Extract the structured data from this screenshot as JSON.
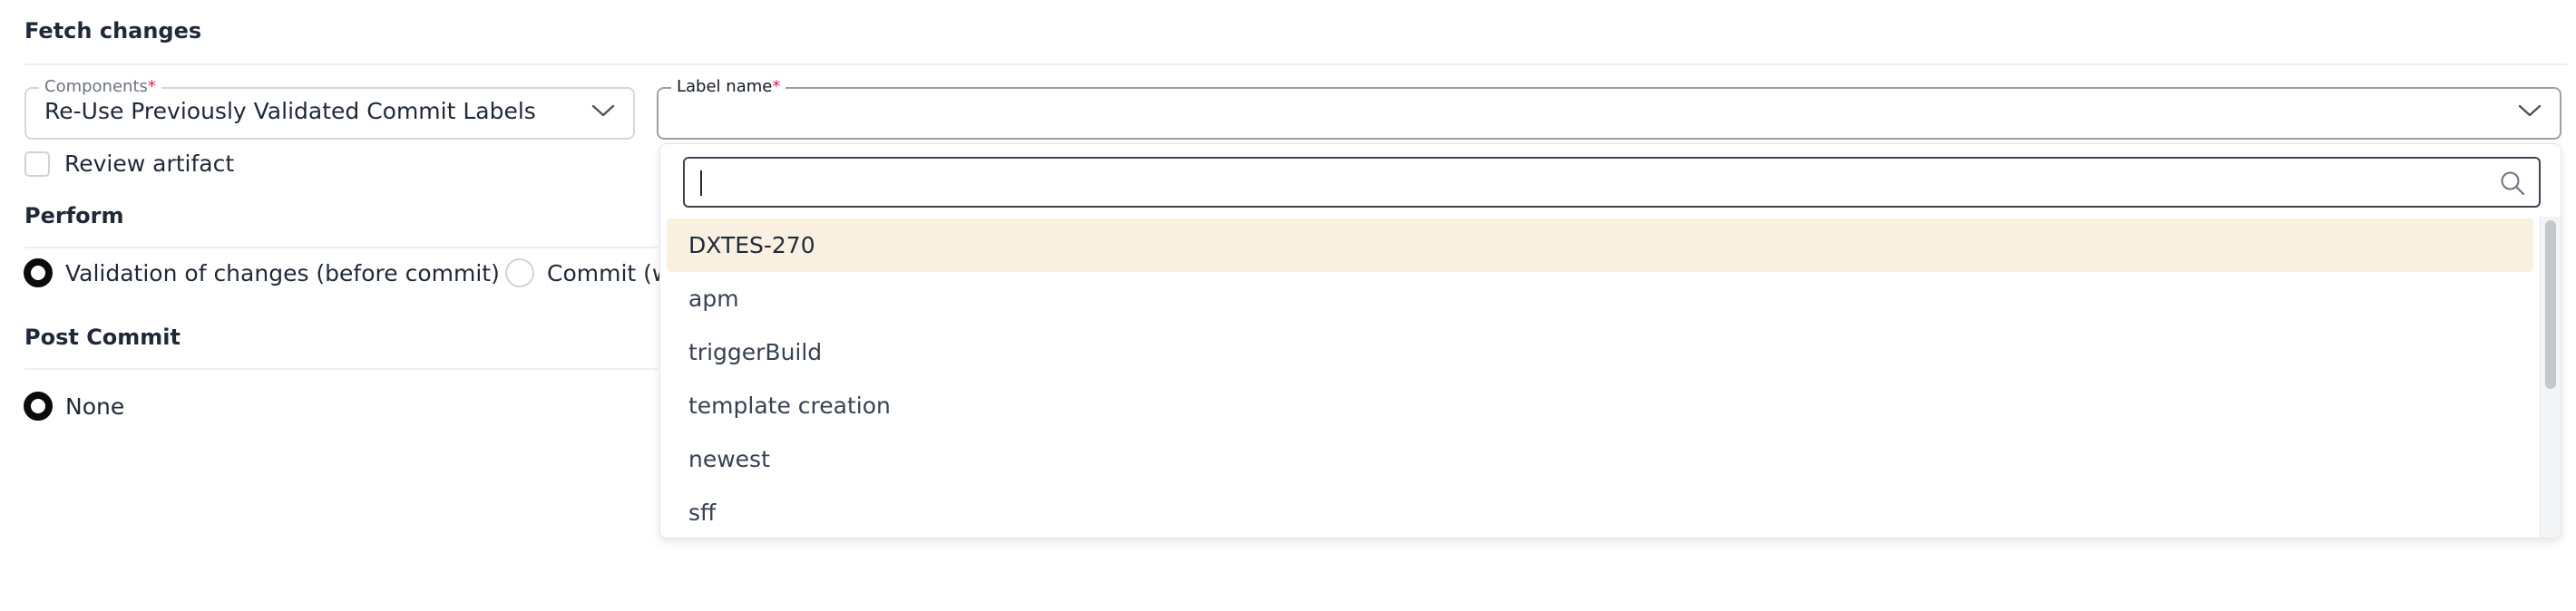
{
  "fetch_changes": {
    "title": "Fetch changes",
    "components": {
      "legend": "Components",
      "required_mark": "*",
      "value": "Re-Use Previously Validated Commit Labels"
    },
    "label_name": {
      "legend": "Label name",
      "required_mark": "*",
      "value": ""
    },
    "review_artifact_label": "Review artifact"
  },
  "perform": {
    "title": "Perform",
    "options": [
      {
        "label": "Validation of changes (before commit)",
        "checked": true
      },
      {
        "label": "Commit (w",
        "checked": false
      }
    ]
  },
  "post_commit": {
    "title": "Post Commit",
    "options": [
      {
        "label": "None",
        "checked": true
      }
    ]
  },
  "dropdown": {
    "search_value": "",
    "options": [
      {
        "label": "DXTES-270",
        "highlighted": true
      },
      {
        "label": "apm",
        "highlighted": false
      },
      {
        "label": "triggerBuild",
        "highlighted": false
      },
      {
        "label": "template creation",
        "highlighted": false
      },
      {
        "label": "newest",
        "highlighted": false
      },
      {
        "label": "sff",
        "highlighted": false
      }
    ]
  },
  "colors": {
    "highlight": "#f9f0e1",
    "required": "#e11d48",
    "text": "#1f2937"
  },
  "icons": [
    "chevron-down-icon",
    "search-icon"
  ]
}
